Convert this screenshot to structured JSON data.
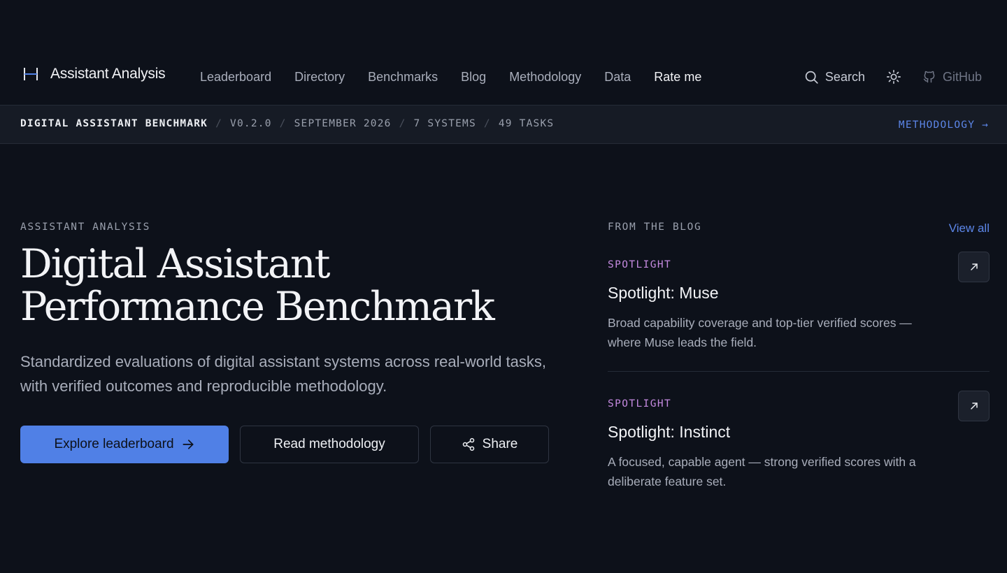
{
  "header": {
    "brand": "Assistant Analysis",
    "nav": [
      {
        "label": "Leaderboard"
      },
      {
        "label": "Directory"
      },
      {
        "label": "Benchmarks"
      },
      {
        "label": "Blog"
      },
      {
        "label": "Methodology"
      },
      {
        "label": "Data"
      },
      {
        "label": "Rate me"
      }
    ],
    "search_label": "Search",
    "github_label": "GitHub"
  },
  "subbar": {
    "crumbs": [
      "DIGITAL ASSISTANT BENCHMARK",
      "V0.2.0",
      "SEPTEMBER 2026",
      "7 SYSTEMS",
      "49 TASKS"
    ],
    "link_label": "METHODOLOGY →"
  },
  "hero": {
    "eyebrow": "ASSISTANT ANALYSIS",
    "title": "Digital Assistant Performance Benchmark",
    "subtitle": "Standardized evaluations of digital assistant systems across real-world tasks, with verified outcomes and reproducible methodology.",
    "primary_label": "Explore leaderboard",
    "read_label": "Read methodology",
    "share_label": "Share"
  },
  "blog": {
    "eyebrow": "FROM THE BLOG",
    "view_all": "View all",
    "posts": [
      {
        "tag": "SPOTLIGHT",
        "title": "Spotlight: Muse",
        "desc": "Broad capability coverage and top-tier verified scores — where Muse leads the field."
      },
      {
        "tag": "SPOTLIGHT",
        "title": "Spotlight: Instinct",
        "desc": "A focused, capable agent — strong verified scores with a deliberate feature set."
      }
    ]
  },
  "colors": {
    "background": "#0d111a",
    "accent": "#5080e6",
    "tag": "#c58ae0"
  }
}
